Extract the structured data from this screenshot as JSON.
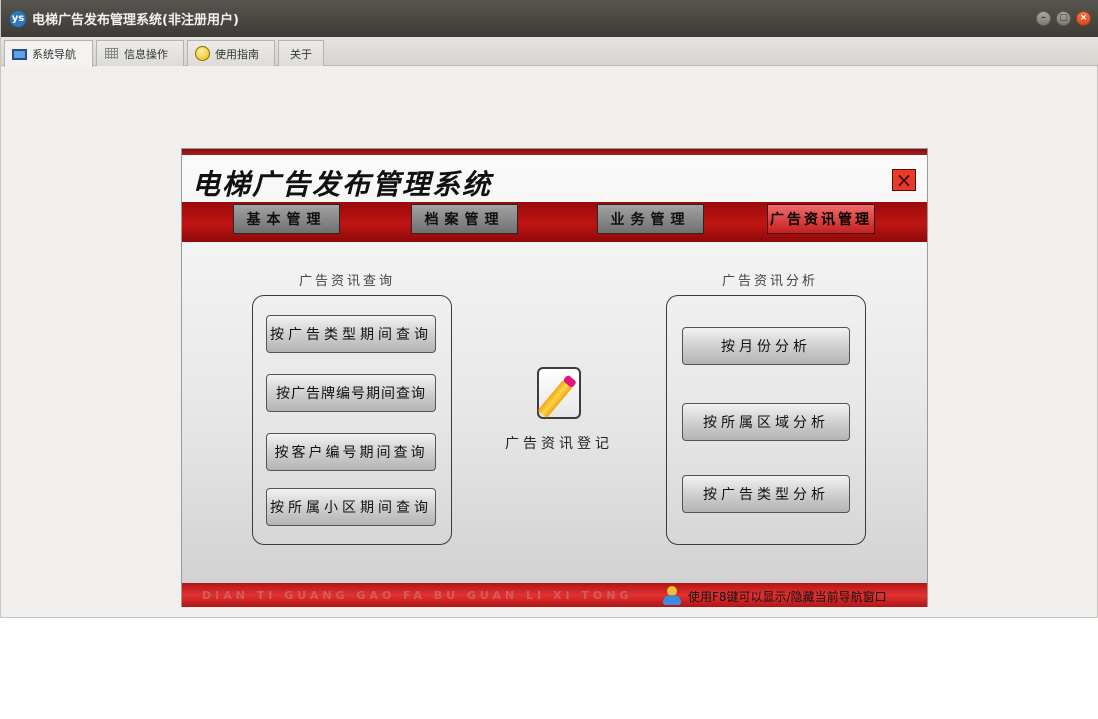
{
  "window": {
    "app_icon_text": "ys",
    "title": "电梯广告发布管理系统(非注册用户)",
    "controls": [
      "–",
      "□",
      "×"
    ]
  },
  "tabs": [
    {
      "label": "系统导航",
      "icon": "monitor-icon",
      "active": true
    },
    {
      "label": "信息操作",
      "icon": "grid-icon",
      "active": false
    },
    {
      "label": "使用指南",
      "icon": "help-icon",
      "active": false
    },
    {
      "label": "关于",
      "icon": "",
      "active": false
    }
  ],
  "panel": {
    "title": "电梯广告发布管理系统",
    "close_icon": "×",
    "menu": [
      {
        "label": "基本管理",
        "active": false
      },
      {
        "label": "档案管理",
        "active": false
      },
      {
        "label": "业务管理",
        "active": false
      },
      {
        "label": "广告资讯管理",
        "active": true
      }
    ],
    "query_section": {
      "title": "广告资讯查询",
      "buttons": [
        "按广告类型期间查询",
        "按广告牌编号期间查询",
        "按客户编号期间查询",
        "按所属小区期间查询"
      ]
    },
    "register": {
      "label": "广告资讯登记",
      "icon": "edit-document-icon"
    },
    "analysis_section": {
      "title": "广告资讯分析",
      "buttons": [
        "按月份分析",
        "按所属区域分析",
        "按广告类型分析"
      ]
    },
    "footer": {
      "pinyin": "DIAN TI GUANG GAO FA BU GUAN LI XI TONG",
      "tip": "使用F8键可以显示/隐藏当前导航窗口",
      "tip_icon": "user-icon"
    }
  },
  "colors": {
    "accent_red": "#c01414",
    "titlebar": "#3d3b36"
  }
}
